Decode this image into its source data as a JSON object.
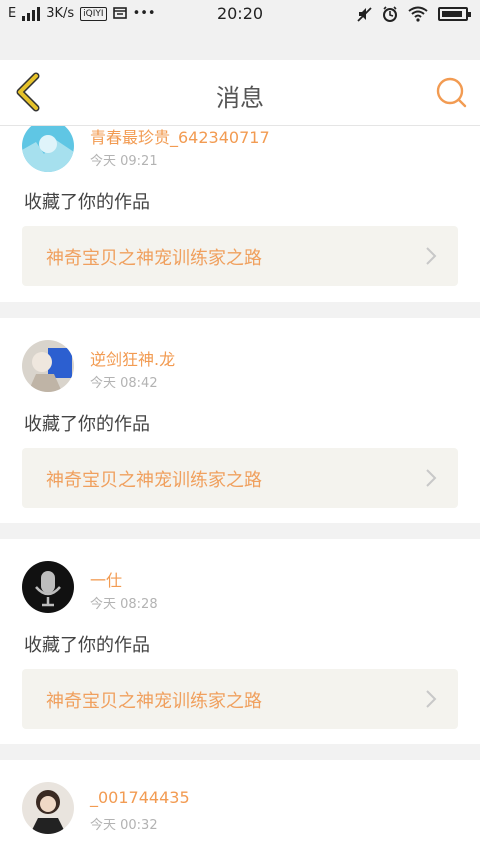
{
  "status_bar": {
    "carrier": "E",
    "speed": "3K/s",
    "app_badge": "iQIYI",
    "more": "•••",
    "time": "20:20"
  },
  "nav": {
    "title": "消息",
    "back_icon": "back-chevron-icon",
    "search_icon": "search-icon"
  },
  "colors": {
    "accent": "#f29b52",
    "back_icon_yellow": "#e6c229",
    "card_bg": "#f4f3ee"
  },
  "messages": [
    {
      "user": "青春最珍贵_642340717",
      "time": "今天 09:21",
      "action": "收藏了你的作品",
      "work": "神奇宝贝之神宠训练家之路"
    },
    {
      "user": "逆剑狂神.龙",
      "time": "今天 08:42",
      "action": "收藏了你的作品",
      "work": "神奇宝贝之神宠训练家之路"
    },
    {
      "user": "一仕",
      "time": "今天 08:28",
      "action": "收藏了你的作品",
      "work": "神奇宝贝之神宠训练家之路"
    },
    {
      "user": "_001744435",
      "time": "今天 00:32"
    }
  ]
}
